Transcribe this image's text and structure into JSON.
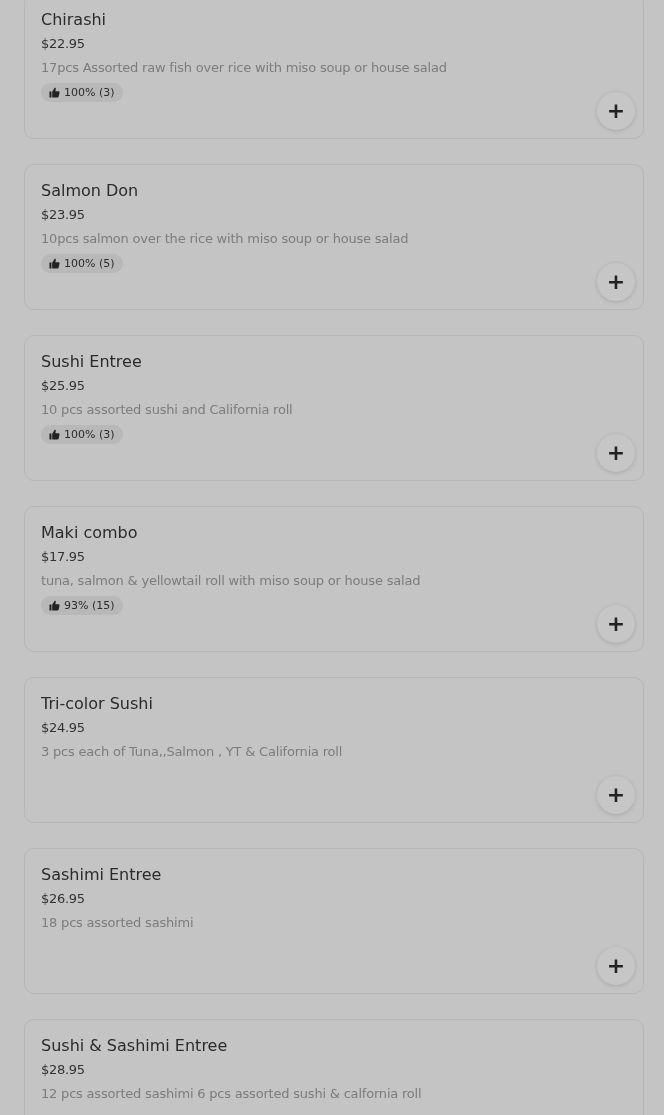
{
  "items": [
    {
      "name": "Chirashi",
      "price": "$22.95",
      "description": "17pcs Assorted raw fish over rice with miso soup or house salad",
      "rating": "100% (3)",
      "add": "+"
    },
    {
      "name": "Salmon Don",
      "price": "$23.95",
      "description": "10pcs salmon over the rice with miso soup or house salad",
      "rating": "100% (5)",
      "add": "+"
    },
    {
      "name": "Sushi Entree",
      "price": "$25.95",
      "description": "10 pcs assorted sushi and California roll",
      "rating": "100% (3)",
      "add": "+"
    },
    {
      "name": "Maki combo",
      "price": "$17.95",
      "description": "tuna, salmon & yellowtail roll with miso soup or house salad",
      "rating": "93% (15)",
      "add": "+"
    },
    {
      "name": "Tri-color Sushi",
      "price": "$24.95",
      "description": "3 pcs each of Tuna,,Salmon , YT & California roll",
      "add": "+"
    },
    {
      "name": "Sashimi Entree",
      "price": "$26.95",
      "description": "18 pcs assorted sashimi",
      "add": "+"
    },
    {
      "name": "Sushi & Sashimi Entree",
      "price": "$28.95",
      "description": "12 pcs assorted sashimi 6 pcs assorted sushi & calfornia roll"
    }
  ]
}
